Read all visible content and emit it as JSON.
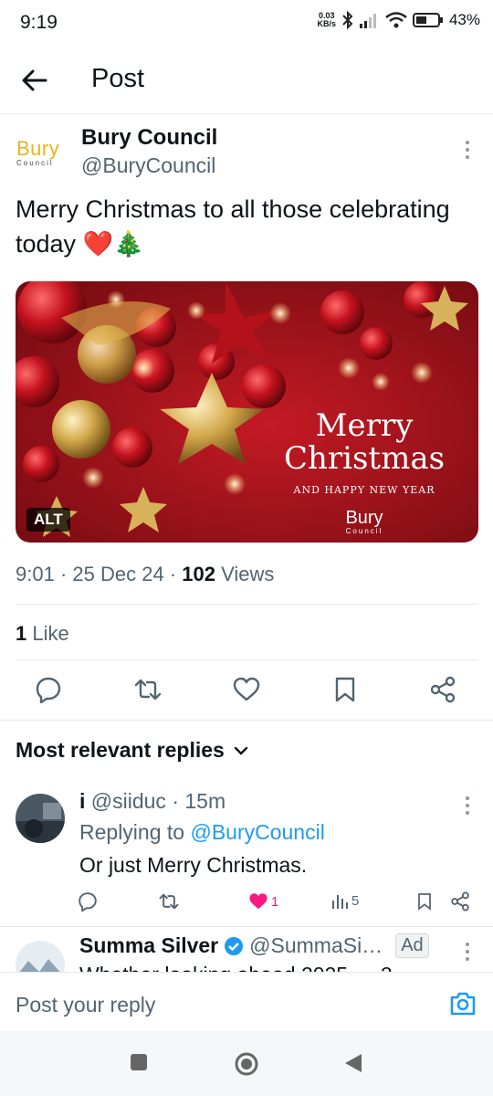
{
  "status": {
    "time": "9:19",
    "kbs": "0.03\nKB/s",
    "battery": "43%"
  },
  "header": {
    "title": "Post"
  },
  "post": {
    "author_name": "Bury Council",
    "author_handle": "@BuryCouncil",
    "logo": {
      "word": "Bury",
      "sub": "Council"
    },
    "text": "Merry Christmas to all those celebrating today ❤️🎄",
    "media": {
      "line1": "Merry",
      "line2": "Christmas",
      "line3": "AND HAPPY NEW YEAR",
      "brand": "Bury",
      "brand_sub": "Council",
      "alt_badge": "ALT"
    },
    "meta": {
      "time": "9:01",
      "date": "25 Dec 24",
      "views_count": "102",
      "views_label": "Views"
    },
    "likes": {
      "count": "1",
      "label": "Like"
    }
  },
  "replies_filter": {
    "label": "Most relevant replies"
  },
  "reply": {
    "name": "i",
    "handle": "@siiduc",
    "age": "15m",
    "replying_prefix": "Replying to",
    "replying_to": "@BuryCouncil",
    "text": "Or just Merry Christmas.",
    "like_count": "1",
    "view_count": "5"
  },
  "ad": {
    "name": "Summa Silver",
    "handle": "@SummaSi…",
    "badge": "Ad",
    "preview": "Whether looking ahead 2025 → 2"
  },
  "composer": {
    "placeholder": "Post your reply"
  },
  "colors": {
    "accent": "#1d9bf0",
    "like_pink": "#f91880",
    "text": "#0f1419",
    "secondary": "#536471"
  }
}
